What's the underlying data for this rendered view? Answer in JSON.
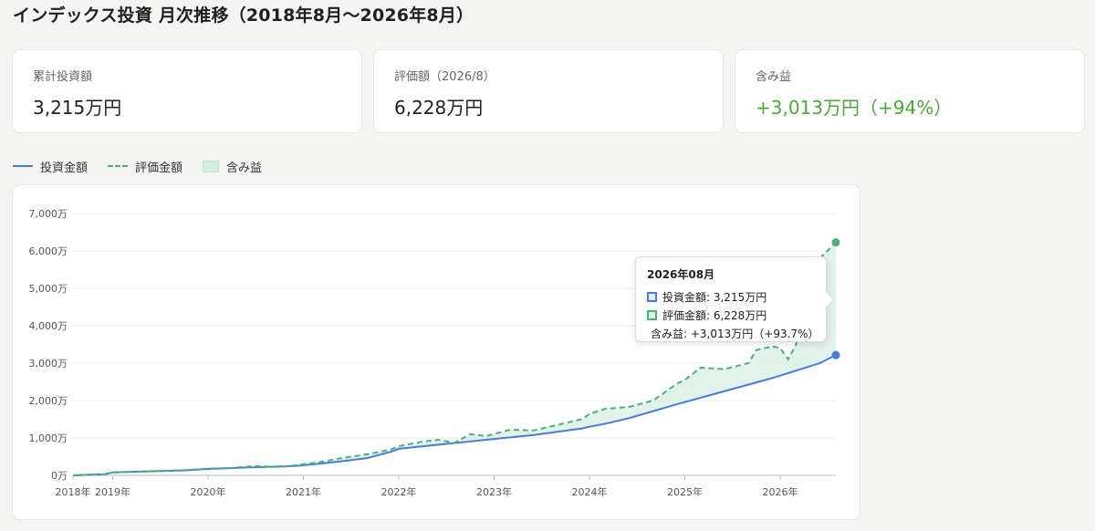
{
  "title": "インデックス投資 月次推移（2018年8月〜2026年8月）",
  "cards": [
    {
      "label": "累計投資額",
      "value": "3,215万円"
    },
    {
      "label": "評価額（2026/8）",
      "value": "6,228万円"
    },
    {
      "label": "含み益",
      "value": "+3,013万円（+94%）"
    }
  ],
  "legend": {
    "invested": "投資金額",
    "valuation": "評価金額",
    "gain": "含み益"
  },
  "tooltip": {
    "title": "2026年08月",
    "invested": "投資金額: 3,215万円",
    "valuation": "評価金額: 6,228万円",
    "gain": "含み益: +3,013万円（+93.7%）"
  },
  "colors": {
    "invested": "#4a7bd6",
    "valuation": "#4faf7a",
    "gain_fill": "#d6ede3",
    "gain_text": "#4aa83a"
  },
  "chart_data": {
    "type": "area",
    "x_unit": "年",
    "yunit": "万",
    "ylim": [
      0,
      7000
    ],
    "y_ticks": [
      0,
      1000,
      2000,
      3000,
      4000,
      5000,
      6000,
      7000
    ],
    "y_tick_labels": [
      "0万",
      "1,000万",
      "2,000万",
      "3,000万",
      "4,000万",
      "5,000万",
      "6,000万",
      "7,000万"
    ],
    "x_ticks": [
      "2018-08",
      "2019-01",
      "2020-01",
      "2021-01",
      "2022-01",
      "2023-01",
      "2024-01",
      "2025-01",
      "2026-01"
    ],
    "x_tick_labels": [
      "2018年",
      "2019年",
      "2020年",
      "2021年",
      "2022年",
      "2023年",
      "2024年",
      "2025年",
      "2026年"
    ],
    "xlim": [
      "2018-08",
      "2026-08"
    ],
    "grid": true,
    "legend_position": "top-left",
    "series": [
      {
        "name": "投資金額",
        "style": "solid",
        "points": [
          [
            "2018-08",
            0
          ],
          [
            "2018-12",
            30
          ],
          [
            "2019-01",
            80
          ],
          [
            "2019-06",
            110
          ],
          [
            "2019-10",
            130
          ],
          [
            "2020-01",
            170
          ],
          [
            "2020-06",
            210
          ],
          [
            "2020-12",
            250
          ],
          [
            "2021-03",
            310
          ],
          [
            "2021-06",
            380
          ],
          [
            "2021-09",
            460
          ],
          [
            "2021-12",
            630
          ],
          [
            "2022-01",
            710
          ],
          [
            "2022-06",
            820
          ],
          [
            "2022-12",
            950
          ],
          [
            "2023-06",
            1080
          ],
          [
            "2023-12",
            1250
          ],
          [
            "2024-01",
            1300
          ],
          [
            "2024-03",
            1380
          ],
          [
            "2024-06",
            1530
          ],
          [
            "2024-12",
            1900
          ],
          [
            "2025-06",
            2250
          ],
          [
            "2025-12",
            2600
          ],
          [
            "2026-06",
            3000
          ],
          [
            "2026-08",
            3215
          ]
        ]
      },
      {
        "name": "評価金額",
        "style": "dashed",
        "points": [
          [
            "2018-08",
            0
          ],
          [
            "2018-12",
            30
          ],
          [
            "2019-01",
            80
          ],
          [
            "2019-06",
            110
          ],
          [
            "2019-10",
            140
          ],
          [
            "2020-01",
            180
          ],
          [
            "2020-04",
            200
          ],
          [
            "2020-07",
            250
          ],
          [
            "2020-10",
            220
          ],
          [
            "2020-12",
            270
          ],
          [
            "2021-03",
            350
          ],
          [
            "2021-06",
            470
          ],
          [
            "2021-09",
            560
          ],
          [
            "2021-12",
            690
          ],
          [
            "2022-01",
            780
          ],
          [
            "2022-04",
            900
          ],
          [
            "2022-06",
            950
          ],
          [
            "2022-08",
            870
          ],
          [
            "2022-10",
            1100
          ],
          [
            "2022-12",
            1050
          ],
          [
            "2023-03",
            1220
          ],
          [
            "2023-06",
            1200
          ],
          [
            "2023-09",
            1350
          ],
          [
            "2023-12",
            1500
          ],
          [
            "2024-01",
            1640
          ],
          [
            "2024-03",
            1780
          ],
          [
            "2024-06",
            1830
          ],
          [
            "2024-09",
            2000
          ],
          [
            "2024-12",
            2450
          ],
          [
            "2025-01",
            2550
          ],
          [
            "2025-03",
            2880
          ],
          [
            "2025-06",
            2840
          ],
          [
            "2025-09",
            3000
          ],
          [
            "2025-10",
            3350
          ],
          [
            "2025-12",
            3450
          ],
          [
            "2026-01",
            3400
          ],
          [
            "2026-02",
            3100
          ],
          [
            "2026-03",
            3500
          ],
          [
            "2026-04",
            4600
          ],
          [
            "2026-06",
            5800
          ],
          [
            "2026-08",
            6228
          ]
        ]
      }
    ]
  }
}
